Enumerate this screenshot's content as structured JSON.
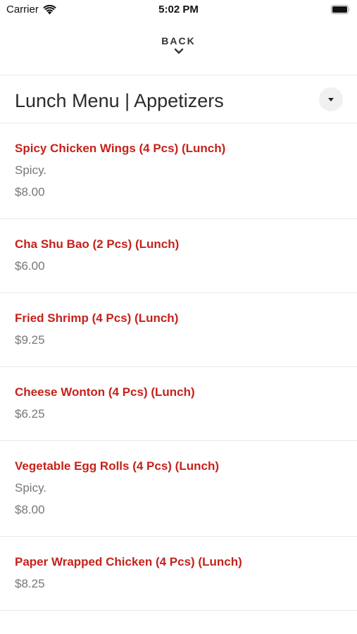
{
  "status_bar": {
    "carrier": "Carrier",
    "time": "5:02 PM"
  },
  "nav": {
    "back_label": "BACK"
  },
  "header": {
    "title": "Lunch Menu | Appetizers"
  },
  "colors": {
    "item_name": "#c5221a",
    "secondary_text": "#777777",
    "divider": "#e9e9e9"
  },
  "menu_items": [
    {
      "name": "Spicy Chicken Wings (4 Pcs) (Lunch)",
      "desc": "Spicy.",
      "price": "$8.00"
    },
    {
      "name": "Cha Shu Bao (2 Pcs) (Lunch)",
      "desc": "",
      "price": "$6.00"
    },
    {
      "name": "Fried Shrimp (4 Pcs) (Lunch)",
      "desc": "",
      "price": "$9.25"
    },
    {
      "name": "Cheese Wonton (4 Pcs) (Lunch)",
      "desc": "",
      "price": "$6.25"
    },
    {
      "name": "Vegetable Egg Rolls (4 Pcs) (Lunch)",
      "desc": "Spicy.",
      "price": "$8.00"
    },
    {
      "name": "Paper Wrapped Chicken (4 Pcs) (Lunch)",
      "desc": "",
      "price": "$8.25"
    }
  ]
}
